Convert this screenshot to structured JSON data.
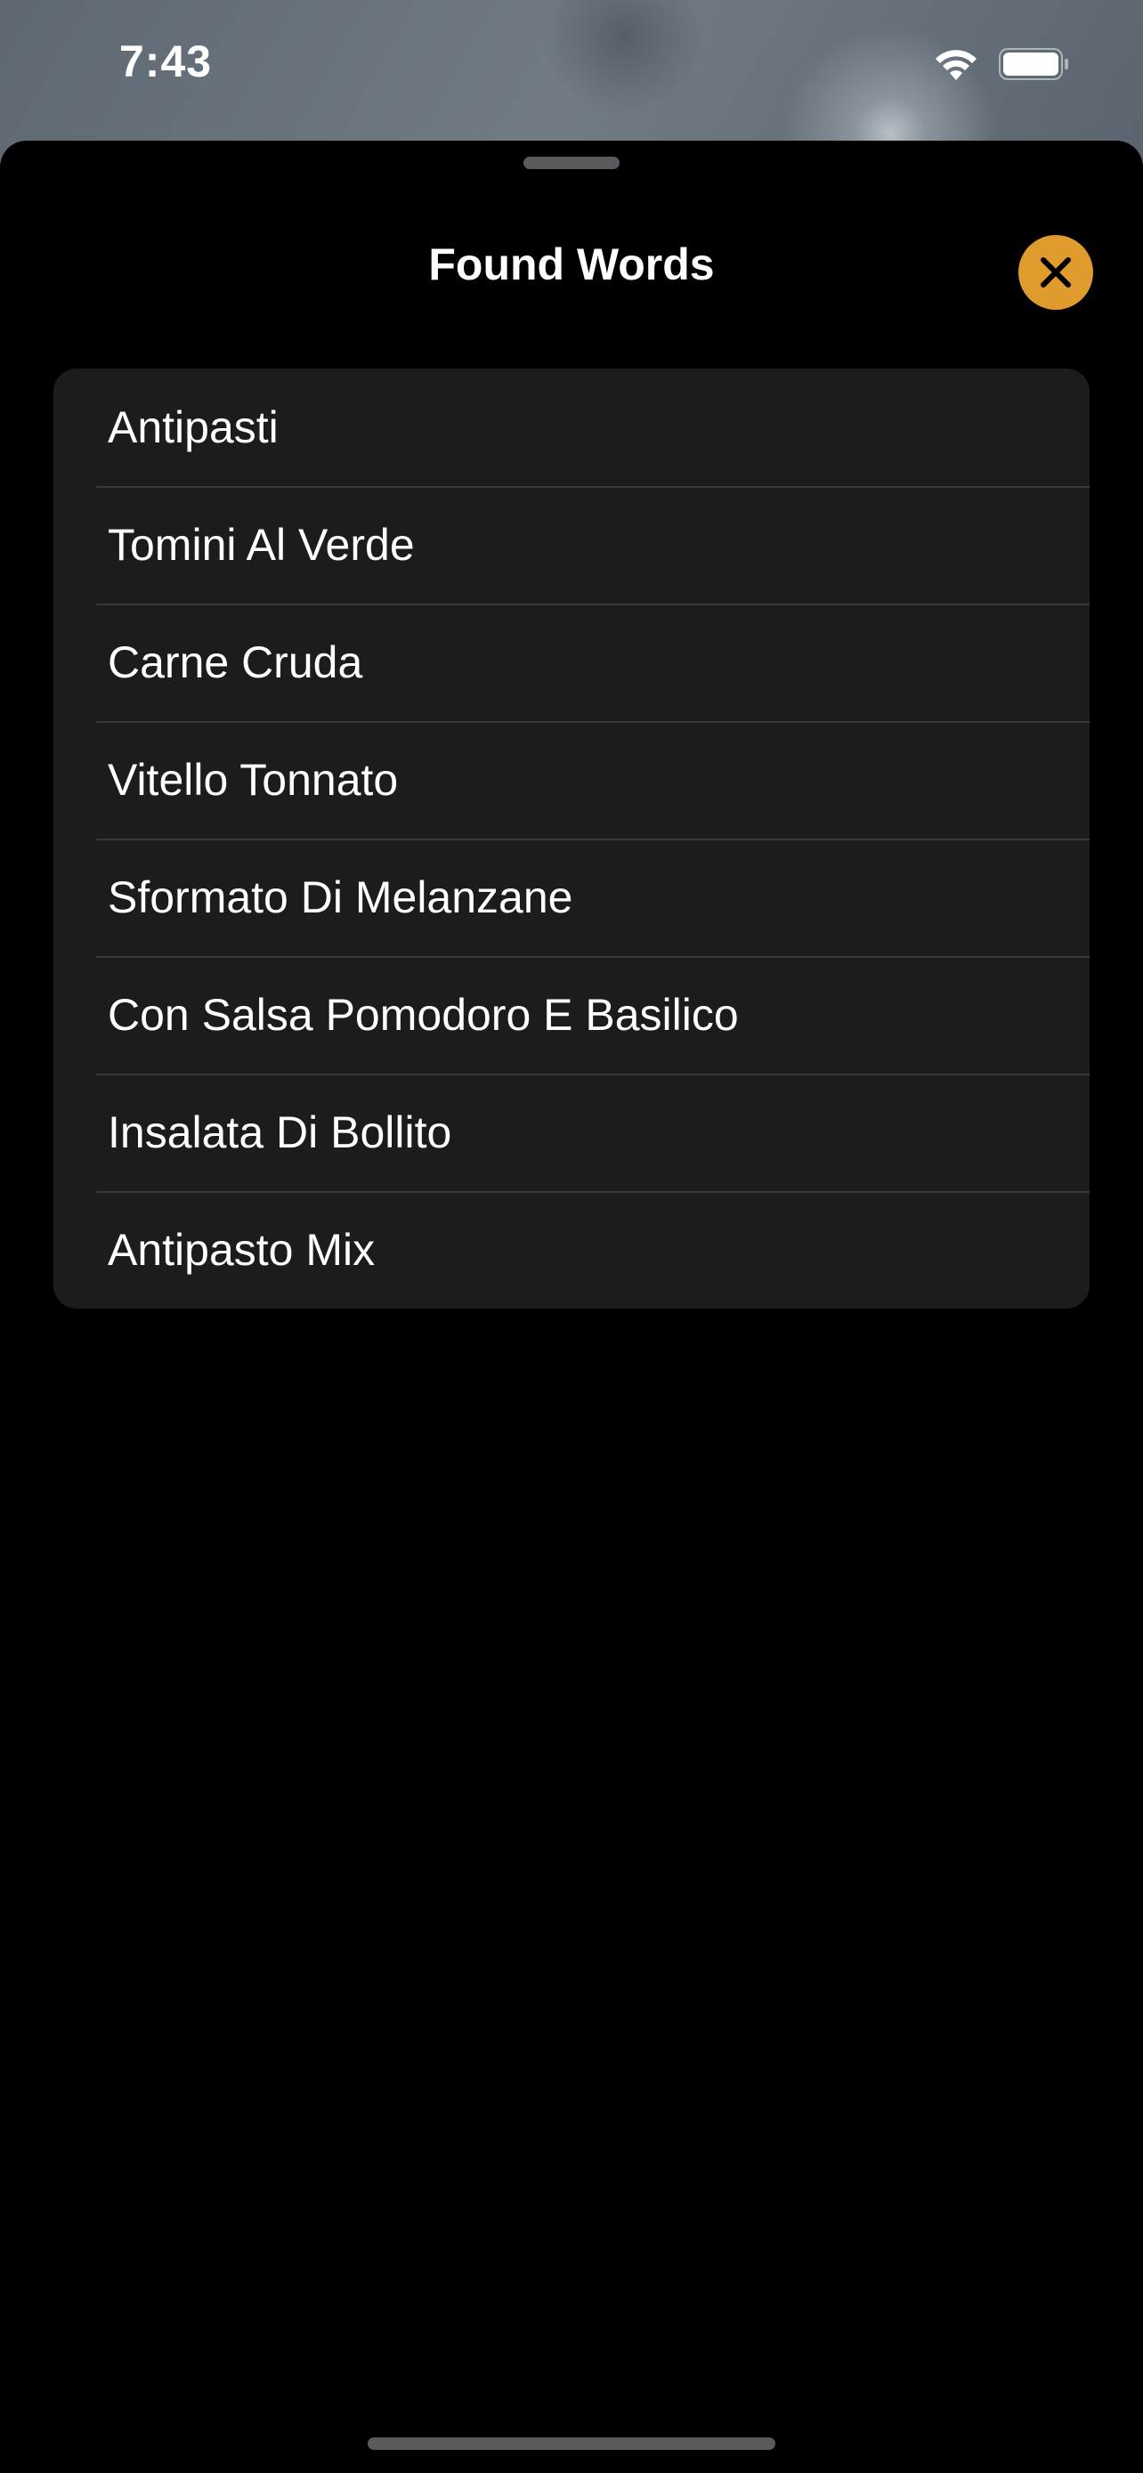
{
  "status_bar": {
    "time": "7:43"
  },
  "sheet": {
    "title": "Found Words",
    "close_icon": "xmark-icon",
    "accent_color": "#e09b2d"
  },
  "found_words": [
    "Antipasti",
    "Tomini Al Verde",
    "Carne Cruda",
    "Vitello Tonnato",
    "Sformato Di Melanzane",
    "Con Salsa Pomodoro E Basilico",
    "Insalata Di Bollito",
    "Antipasto Mix"
  ]
}
